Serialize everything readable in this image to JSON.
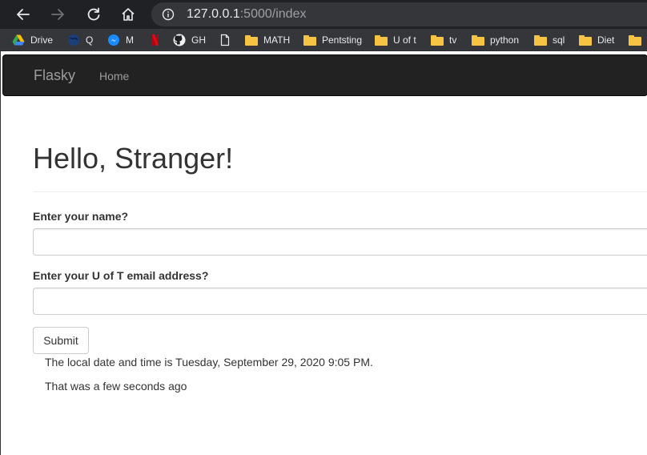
{
  "browser": {
    "url_host": "127.0.0.1",
    "url_path": ":5000/index",
    "bookmarks": [
      {
        "label": "Drive",
        "icon": "google-drive-icon"
      },
      {
        "label": "Q",
        "icon": "globe-icon"
      },
      {
        "label": "M",
        "icon": "messenger-icon"
      },
      {
        "label": "",
        "icon": "netflix-icon"
      },
      {
        "label": "GH",
        "icon": "github-icon"
      },
      {
        "label": "",
        "icon": "page-icon"
      },
      {
        "label": "MATH",
        "icon": "folder-icon"
      },
      {
        "label": "Pentsting",
        "icon": "folder-icon"
      },
      {
        "label": "U of t",
        "icon": "folder-icon"
      },
      {
        "label": "tv",
        "icon": "folder-icon"
      },
      {
        "label": "python",
        "icon": "folder-icon"
      },
      {
        "label": "sql",
        "icon": "folder-icon"
      },
      {
        "label": "Diet",
        "icon": "folder-icon"
      },
      {
        "label": "",
        "icon": "folder-icon"
      }
    ]
  },
  "navbar": {
    "brand": "Flasky",
    "links": [
      "Home"
    ]
  },
  "main": {
    "heading": "Hello, Stranger!",
    "form": {
      "name_label": "Enter your name?",
      "name_value": "",
      "email_label": "Enter your U of T email address?",
      "email_value": "",
      "submit_label": "Submit"
    },
    "local_datetime_text": "The local date and time is Tuesday, September 29, 2020 9:05 PM.",
    "relative_time_text": "That was a few seconds ago"
  },
  "colors": {
    "chrome_dark": "#202124",
    "bookmark_bar": "#35363a",
    "navbar_bg": "#222222",
    "navbar_text": "#9d9d9d",
    "folder": "#f6c342"
  }
}
